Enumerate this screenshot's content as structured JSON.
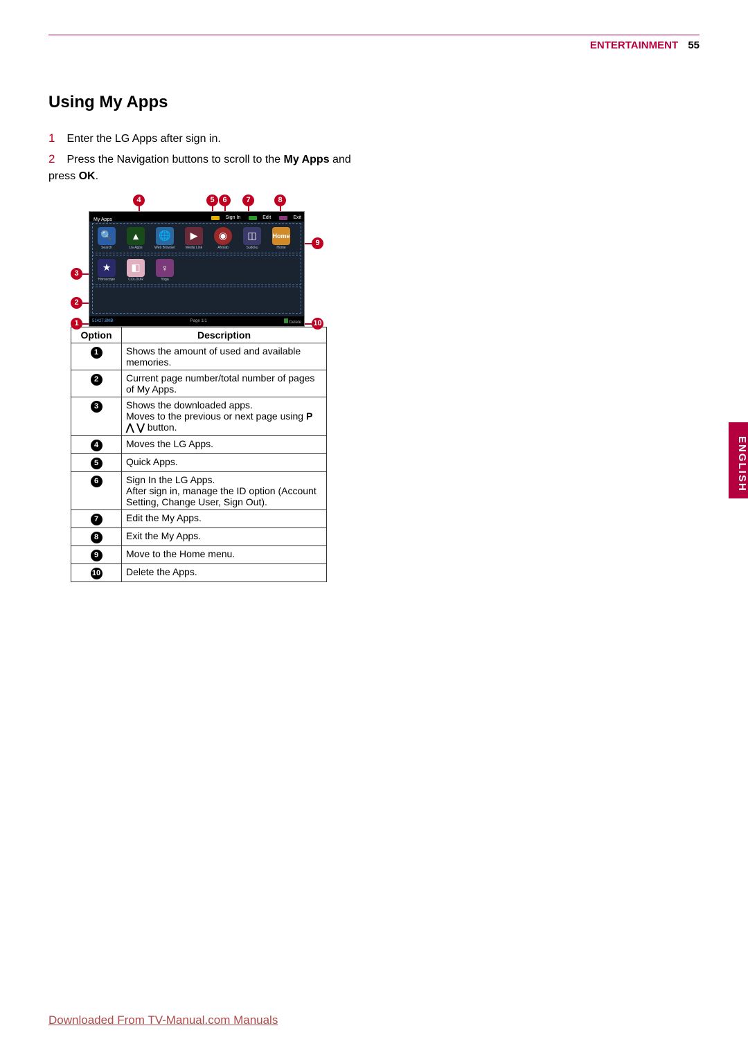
{
  "header": {
    "section": "ENTERTAINMENT",
    "page": "55"
  },
  "title": "Using My Apps",
  "steps": {
    "s1num": "1",
    "s1": "Enter the LG Apps after sign in.",
    "s2num": "2",
    "s2a": "Press the Navigation buttons to scroll to the ",
    "s2b": "My Apps",
    "s2c": " and press ",
    "s2d": "OK",
    "s2e": "."
  },
  "screen": {
    "title": "My Apps",
    "signin": "Sign In",
    "edit": "Edit",
    "exit": "Exit",
    "row1": {
      "search": "Search",
      "lgapps": "LG Apps",
      "browser": "Web Browser",
      "media": "Media Link",
      "aholab": "Aholab",
      "sudoku": "Sudoku",
      "home": "Home",
      "homeLabel": "Home"
    },
    "row2": {
      "horo": "Horoscope",
      "colour": "COLOUR",
      "yoga": "Yoga"
    },
    "memory": "51427.8MB",
    "page": "Page 1/1",
    "delete": "Delete"
  },
  "callouts": {
    "c1": "1",
    "c2": "2",
    "c3": "3",
    "c4": "4",
    "c5": "5",
    "c6": "6",
    "c7": "7",
    "c8": "8",
    "c9": "9",
    "c10": "10"
  },
  "table": {
    "hOption": "Option",
    "hDesc": "Description",
    "r1": "Shows the amount of used and available memories.",
    "r2": "Current page number/total number of pages of My Apps.",
    "r3a": "Shows the downloaded apps.",
    "r3b": "Moves to the previous or next page using ",
    "r3c": "P ⋀ ⋁",
    "r3d": " button.",
    "r4": "Moves the LG Apps.",
    "r5": "Quick Apps.",
    "r6a": "Sign In the LG Apps.",
    "r6b": "After sign in, manage the ID option (Account Setting, Change User, Sign Out).",
    "r7": "Edit the My Apps.",
    "r8": "Exit the My Apps.",
    "r9": "Move to the Home menu.",
    "r10": "Delete the Apps."
  },
  "sidetab": "ENGLISH",
  "footer": "Downloaded From TV-Manual.com Manuals"
}
